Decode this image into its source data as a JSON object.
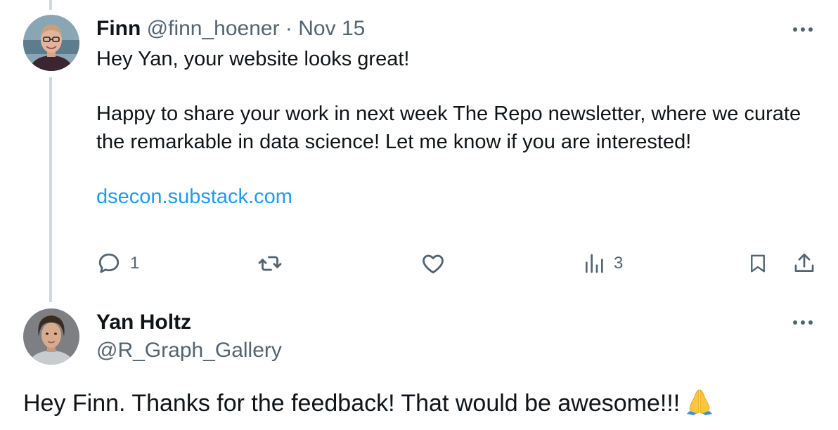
{
  "tweet1": {
    "author_name": "Finn",
    "author_handle": "@finn_hoener",
    "separator": "·",
    "date": "Nov 15",
    "text_p1": "Hey Yan, your website looks great!",
    "text_p2": "Happy to share your work in next week The Repo newsletter, where we curate the remarkable in data science! Let me know if you are interested!",
    "link": "dsecon.substack.com",
    "actions": {
      "reply_count": "1",
      "views_count": "3"
    }
  },
  "tweet2": {
    "author_name": "Yan Holtz",
    "author_handle": "@R_Graph_Gallery",
    "text": "Hey Finn. Thanks for the feedback! That would be awesome!!!"
  },
  "icons": {
    "more": "more-horizontal-icon",
    "reply": "reply-bubble-icon",
    "retweet": "retweet-icon",
    "like": "heart-icon",
    "views": "views-bars-icon",
    "bookmark": "bookmark-icon",
    "share": "share-upload-icon",
    "emoji": "folded-hands-emoji"
  },
  "colors": {
    "text": "#0f1419",
    "secondary": "#536471",
    "link": "#1d9bf0",
    "thread_line": "#cfd9de"
  }
}
